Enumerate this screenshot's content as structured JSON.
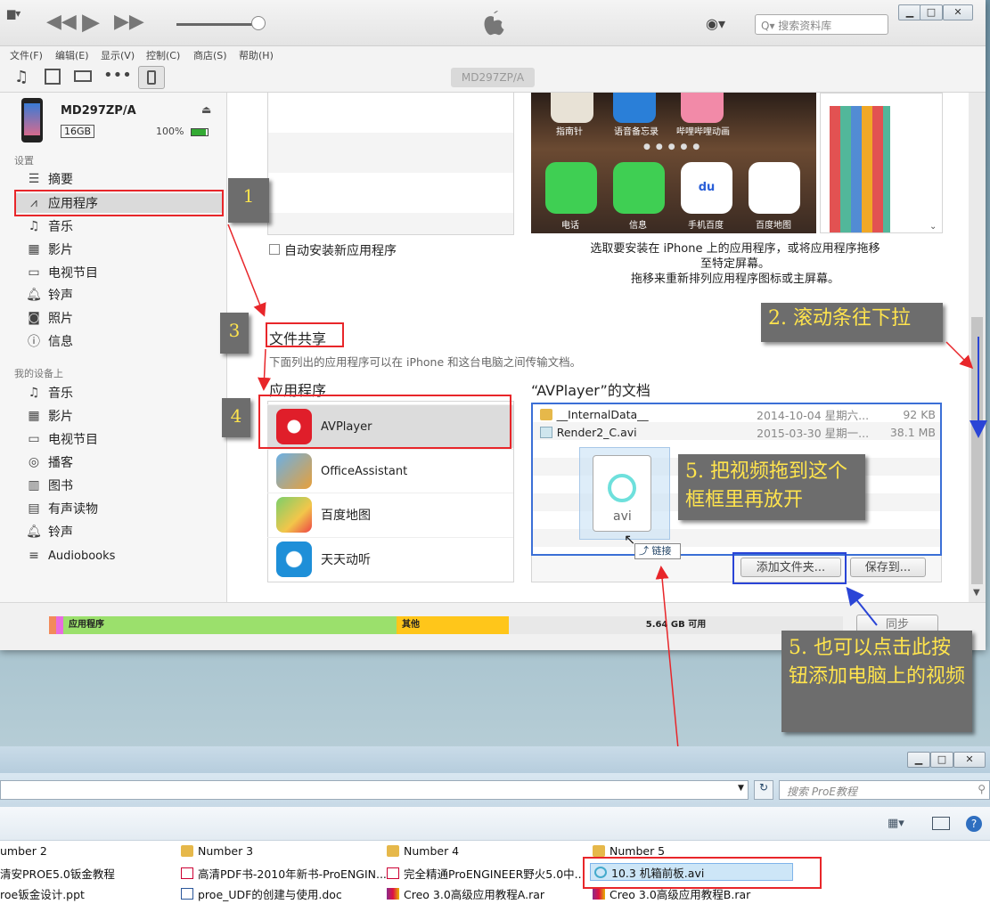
{
  "itunes": {
    "menu": [
      "文件(F)",
      "编辑(E)",
      "显示(V)",
      "控制(C)",
      "商店(S)",
      "帮助(H)"
    ],
    "search_placeholder": "搜索资料库",
    "device_tab": "MD297ZP/A",
    "device": {
      "name": "MD297ZP/A",
      "capacity": "16GB",
      "battery": "100%"
    },
    "sidebar": {
      "settings_header": "设置",
      "settings": [
        "摘要",
        "应用程序",
        "音乐",
        "影片",
        "电视节目",
        "铃声",
        "照片",
        "信息"
      ],
      "ondevice_header": "我的设备上",
      "ondevice": [
        "音乐",
        "影片",
        "电视节目",
        "播客",
        "图书",
        "有声读物",
        "铃声",
        "Audiobooks"
      ]
    },
    "apps_section": {
      "auto_install": "自动安装新应用程序",
      "hint_line1": "选取要安装在 iPhone 上的应用程序，或将应用程序拖移",
      "hint_line2": "至特定屏幕。",
      "hint_line3": "拖移来重新排列应用程序图标或主屏幕。",
      "home_labels_top": [
        "指南针",
        "语音备忘录",
        "哔哩哔哩动画"
      ],
      "home_labels": [
        "电话",
        "信息",
        "手机百度",
        "百度地图"
      ]
    },
    "file_sharing": {
      "title": "文件共享",
      "desc": "下面列出的应用程序可以在 iPhone 和这台电脑之间传输文档。",
      "apps_header": "应用程序",
      "docs_header": "“AVPlayer”的文档",
      "apps": [
        "AVPlayer",
        "OfficeAssistant",
        "百度地图",
        "天天动听"
      ],
      "docs": [
        {
          "name": "__InternalData__",
          "date": "2014-10-04 星期六...",
          "size": "92 KB"
        },
        {
          "name": "Render2_C.avi",
          "date": "2015-03-30 星期一...",
          "size": "38.1 MB"
        }
      ],
      "drag_file_label": "avi",
      "link_tooltip": "链接",
      "add_file_btn": "添加文件夹...",
      "save_to_btn": "保存到..."
    },
    "capacity": {
      "apps": "应用程序",
      "other": "其他",
      "free": "5.64 GB 可用"
    },
    "sync_btn": "同步"
  },
  "annotations": {
    "n1": "1",
    "n3": "3",
    "n4": "4",
    "step2": "2. 滚动条往下拉",
    "step5a": "5. 把视频拖到这个框框里再放开",
    "step5b": "5. 也可以点击此按钮添加电脑上的视频"
  },
  "explorer": {
    "search_placeholder": "搜索 ProE教程",
    "files_col1": [
      "umber 2",
      "清安PROE5.0钣金教程",
      "roe钣金设计.ppt"
    ],
    "files_col2": [
      "Number 3",
      "高清PDF书-2010年新书-ProENGIN...",
      "proe_UDF的创建与使用.doc"
    ],
    "files_col3": [
      "Number 4",
      "完全精通ProENGINEER野火5.0中...",
      "Creo 3.0高级应用教程A.rar"
    ],
    "files_col4": [
      "Number 5",
      "10.3 机箱前板.avi",
      "Creo 3.0高级应用教程B.rar"
    ]
  },
  "colors": {
    "apps_bar": "#9be06c",
    "other_bar": "#ffc61a",
    "annotation_bg": "#6d6d6d",
    "annotation_text": "#ffe44d",
    "red": "#e8262a",
    "blue": "#2a45d6"
  }
}
